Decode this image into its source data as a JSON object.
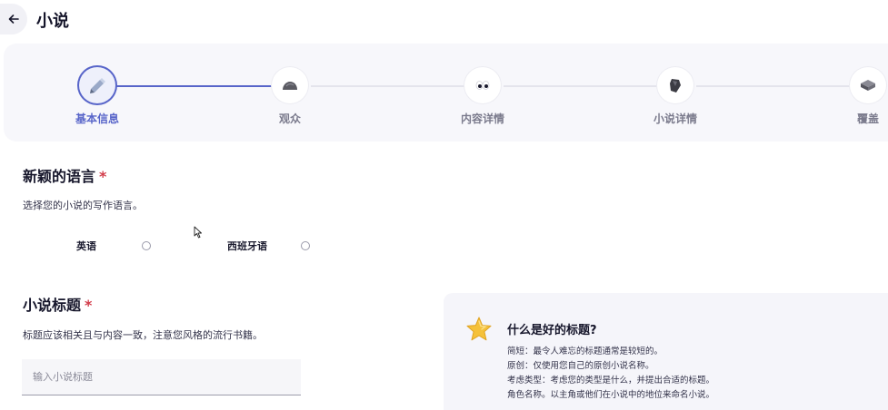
{
  "header": {
    "title": "小说"
  },
  "stepper": {
    "steps": [
      {
        "label": "基本信息",
        "icon": "pencil-icon",
        "active": true
      },
      {
        "label": "观众",
        "icon": "stone-icon",
        "active": false
      },
      {
        "label": "内容详情",
        "icon": "eyes-icon",
        "active": false
      },
      {
        "label": "小说详情",
        "icon": "rock-icon",
        "active": false
      },
      {
        "label": "覆盖",
        "icon": "book-cover-icon",
        "active": false
      }
    ]
  },
  "language": {
    "title": "新颖的语言",
    "required_mark": "*",
    "description": "选择您的小说的写作语言。",
    "options": [
      "英语",
      "西班牙语"
    ]
  },
  "novel_title": {
    "title": "小说标题",
    "required_mark": "*",
    "description": "标题应该相关且与内容一致，注意您风格的流行书籍。",
    "placeholder": "输入小说标题",
    "value": ""
  },
  "tip": {
    "icon": "star-icon",
    "title": "什么是好的标题?",
    "lines": [
      "简短：最令人难忘的标题通常是较短的。",
      "原创：仅使用您自己的原创小说名称。",
      "考虑类型：考虑您的类型是什么，并提出合适的标题。",
      "角色名称。以主角或他们在小说中的地位来命名小说。"
    ]
  },
  "colors": {
    "accent": "#5865c9",
    "required": "#d23c4a",
    "star": "#f5c13a"
  }
}
